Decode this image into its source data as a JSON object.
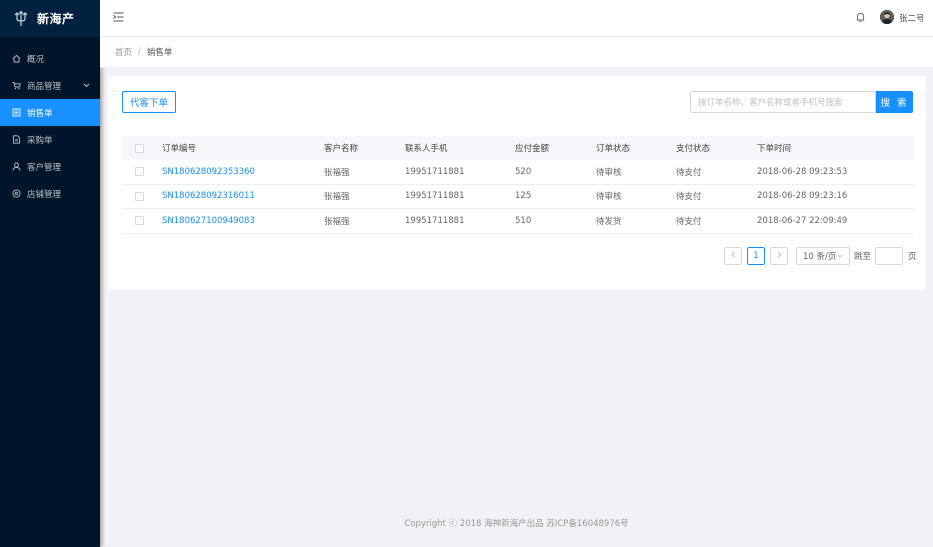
{
  "app": {
    "brand": "新海产",
    "username": "张二号"
  },
  "sidebar": {
    "items": [
      {
        "label": "概况",
        "icon": "home-icon"
      },
      {
        "label": "商品管理",
        "icon": "cart-icon"
      },
      {
        "label": "销售单",
        "icon": "list-icon"
      },
      {
        "label": "采购单",
        "icon": "document-icon"
      },
      {
        "label": "客户管理",
        "icon": "user-icon"
      },
      {
        "label": "店铺管理",
        "icon": "shop-icon"
      }
    ]
  },
  "breadcrumb": {
    "home": "首页",
    "separator": "/",
    "current": "销售单"
  },
  "toolbar": {
    "place_order_label": "代客下单",
    "search_placeholder": "按订单名称、客户名称或者手机号搜索",
    "search_label": "搜 索"
  },
  "table": {
    "headers": [
      "订单编号",
      "客户名称",
      "联系人手机",
      "应付金额",
      "订单状态",
      "支付状态",
      "下单时间"
    ],
    "rows": [
      [
        "SN180628092353360",
        "张福强",
        "19951711881",
        "520",
        "待审核",
        "待支付",
        "2018-06-28 09:23:53"
      ],
      [
        "SN180628092316011",
        "张福强",
        "19951711881",
        "125",
        "待审核",
        "待支付",
        "2018-06-28 09:23:16"
      ],
      [
        "SN180627100949083",
        "张福强",
        "19951711881",
        "510",
        "待发货",
        "待支付",
        "2018-06-27 22:09:49"
      ]
    ]
  },
  "pagination": {
    "current_page": "1",
    "page_size": "10 条/页",
    "jump_label": "跳至",
    "page_unit": "页"
  },
  "footer": {
    "text": "Copyright ⓒ 2018 海神新海产出品 苏ICP备16048976号"
  },
  "colors": {
    "primary": "#1890ff",
    "sidebar_bg": "#001529"
  }
}
